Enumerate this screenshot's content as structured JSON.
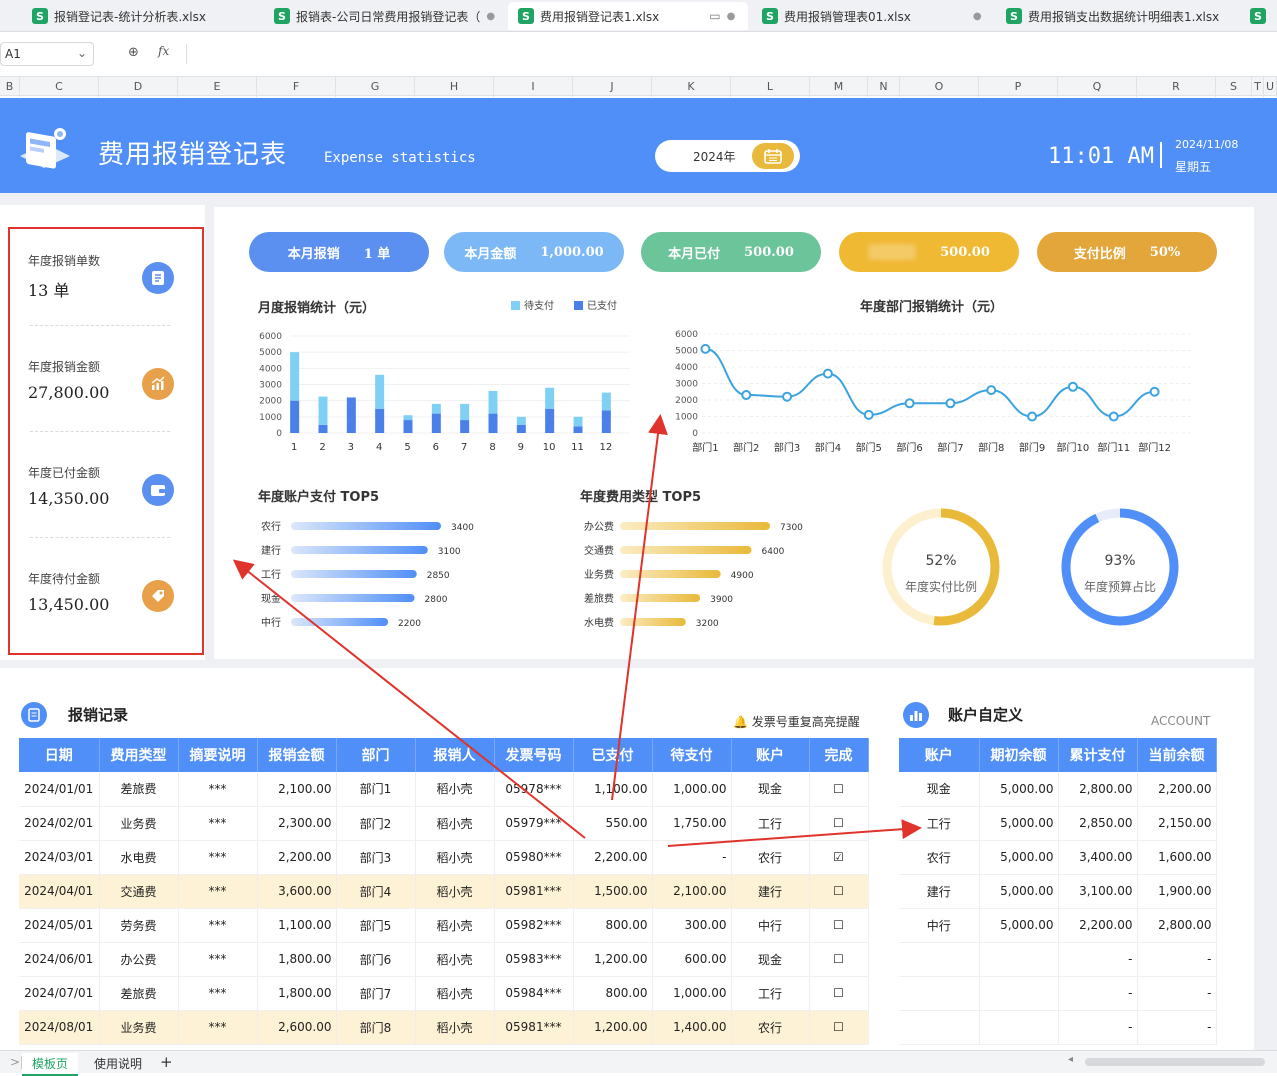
{
  "file_tabs": [
    {
      "label": "报销登记表-统计分析表.xlsx"
    },
    {
      "label": "报销表-公司日常费用报销登记表（"
    },
    {
      "label": "费用报销登记表1.xlsx"
    },
    {
      "label": "费用报销管理表01.xlsx"
    },
    {
      "label": "费用报销支出数据统计明细表1.xlsx"
    }
  ],
  "formula_bar": {
    "cell_ref": "A1",
    "fx": "fx"
  },
  "columns": [
    "B",
    "C",
    "D",
    "E",
    "F",
    "G",
    "H",
    "I",
    "J",
    "K",
    "L",
    "M",
    "N",
    "O",
    "P",
    "Q",
    "R",
    "S",
    "T",
    "U"
  ],
  "header": {
    "title": "费用报销登记表",
    "subtitle": "Expense statistics",
    "year": "2024年",
    "time": "11:01 AM",
    "date": "2024/11/08",
    "weekday": "星期五"
  },
  "stats": [
    {
      "label": "年度报销单数",
      "value": "13 单",
      "icon": "document-icon",
      "color": "#5b8ff0"
    },
    {
      "label": "年度报销金额",
      "value": "27,800.00",
      "icon": "chart-up-icon",
      "color": "#e8a04a"
    },
    {
      "label": "年度已付金额",
      "value": "14,350.00",
      "icon": "wallet-icon",
      "color": "#5b8ff0"
    },
    {
      "label": "年度待付金额",
      "value": "13,450.00",
      "icon": "tag-icon",
      "color": "#e8a04a"
    }
  ],
  "kpis": [
    {
      "label": "本月报销",
      "value": "1 单",
      "color": "#5b8ff0"
    },
    {
      "label": "本月金额",
      "value": "1,000.00",
      "color": "#7cb8f5"
    },
    {
      "label": "本月已付",
      "value": "500.00",
      "color": "#6cc49a"
    },
    {
      "label": "",
      "value": "500.00",
      "color": "#f0b934"
    },
    {
      "label": "支付比例",
      "value": "50%",
      "color": "#e3a63a"
    }
  ],
  "chart_data": [
    {
      "type": "bar",
      "title": "月度报销统计（元）",
      "categories": [
        "1",
        "2",
        "3",
        "4",
        "5",
        "6",
        "7",
        "8",
        "9",
        "10",
        "11",
        "12"
      ],
      "series": [
        {
          "name": "已支付",
          "values": [
            2000,
            500,
            2200,
            1500,
            800,
            1200,
            800,
            1200,
            500,
            1500,
            400,
            1400
          ],
          "color": "#4a80e8"
        },
        {
          "name": "待支付",
          "values": [
            3000,
            1750,
            0,
            2100,
            300,
            600,
            1000,
            1400,
            500,
            1300,
            600,
            1100
          ],
          "color": "#7fd0f4"
        }
      ],
      "stacked": true,
      "ylim": [
        0,
        6000
      ],
      "yticks": [
        "0",
        "1000",
        "2000",
        "3000",
        "4000",
        "5000",
        "6000"
      ],
      "legend": "top-right"
    },
    {
      "type": "line",
      "title": "年度部门报销统计（元）",
      "categories": [
        "部门1",
        "部门2",
        "部门3",
        "部门4",
        "部门5",
        "部门6",
        "部门7",
        "部门8",
        "部门9",
        "部门10",
        "部门11",
        "部门12"
      ],
      "values": [
        5100,
        2300,
        2200,
        3600,
        1100,
        1800,
        1800,
        2600,
        1000,
        2800,
        1000,
        2500
      ],
      "ylim": [
        0,
        6000
      ],
      "yticks": [
        "0",
        "1000",
        "2000",
        "3000",
        "4000",
        "5000",
        "6000"
      ]
    },
    {
      "type": "bar",
      "title": "年度账户支付 TOP5",
      "categories": [
        "农行",
        "建行",
        "工行",
        "现金",
        "中行"
      ],
      "values": [
        3400,
        3100,
        2850,
        2800,
        2200
      ],
      "orientation": "horizontal"
    },
    {
      "type": "bar",
      "title": "年度费用类型 TOP5",
      "categories": [
        "办公费",
        "交通费",
        "业务费",
        "差旅费",
        "水电费"
      ],
      "values": [
        7300,
        6400,
        4900,
        3900,
        3200
      ],
      "orientation": "horizontal"
    },
    {
      "type": "pie",
      "label": "年度实付比例",
      "value_text": "52%",
      "value": 52,
      "color": "#e9b93a",
      "track": "#fdf0cf"
    },
    {
      "type": "pie",
      "label": "年度预算占比",
      "value_text": "93%",
      "value": 93,
      "color": "#4f8ff7",
      "track": "#e6ecfa"
    }
  ],
  "records": {
    "title": "报销记录",
    "reminder": "发票号重复高亮提醒",
    "headers": [
      "日期",
      "费用类型",
      "摘要说明",
      "报销金额",
      "部门",
      "报销人",
      "发票号码",
      "已支付",
      "待支付",
      "账户",
      "完成"
    ],
    "rows": [
      [
        "2024/01/01",
        "差旅费",
        "***",
        "2,100.00",
        "部门1",
        "稻小壳",
        "05978***",
        "1,100.00",
        "1,000.00",
        "现金",
        "☐"
      ],
      [
        "2024/02/01",
        "业务费",
        "***",
        "2,300.00",
        "部门2",
        "稻小壳",
        "05979***",
        "550.00",
        "1,750.00",
        "工行",
        "☐"
      ],
      [
        "2024/03/01",
        "水电费",
        "***",
        "2,200.00",
        "部门3",
        "稻小壳",
        "05980***",
        "2,200.00",
        "-",
        "农行",
        "☑"
      ],
      [
        "2024/04/01",
        "交通费",
        "***",
        "3,600.00",
        "部门4",
        "稻小壳",
        "05981***",
        "1,500.00",
        "2,100.00",
        "建行",
        "☐"
      ],
      [
        "2024/05/01",
        "劳务费",
        "***",
        "1,100.00",
        "部门5",
        "稻小壳",
        "05982***",
        "800.00",
        "300.00",
        "中行",
        "☐"
      ],
      [
        "2024/06/01",
        "办公费",
        "***",
        "1,800.00",
        "部门6",
        "稻小壳",
        "05983***",
        "1,200.00",
        "600.00",
        "现金",
        "☐"
      ],
      [
        "2024/07/01",
        "差旅费",
        "***",
        "1,800.00",
        "部门7",
        "稻小壳",
        "05984***",
        "800.00",
        "1,000.00",
        "工行",
        "☐"
      ],
      [
        "2024/08/01",
        "业务费",
        "***",
        "2,600.00",
        "部门8",
        "稻小壳",
        "05981***",
        "1,200.00",
        "1,400.00",
        "农行",
        "☐"
      ]
    ],
    "highlight_rows": [
      3,
      7
    ]
  },
  "accounts": {
    "title": "账户自定义",
    "label": "ACCOUNT",
    "headers": [
      "账户",
      "期初余额",
      "累计支付",
      "当前余额"
    ],
    "rows": [
      [
        "现金",
        "5,000.00",
        "2,800.00",
        "2,200.00"
      ],
      [
        "工行",
        "5,000.00",
        "2,850.00",
        "2,150.00"
      ],
      [
        "农行",
        "5,000.00",
        "3,400.00",
        "1,600.00"
      ],
      [
        "建行",
        "5,000.00",
        "3,100.00",
        "1,900.00"
      ],
      [
        "中行",
        "5,000.00",
        "2,200.00",
        "2,800.00"
      ],
      [
        "",
        "",
        "-",
        "-"
      ],
      [
        "",
        "",
        "-",
        "-"
      ],
      [
        "",
        "",
        "-",
        "-"
      ]
    ]
  },
  "sheet_tabs": [
    "模板页",
    "使用说明"
  ]
}
